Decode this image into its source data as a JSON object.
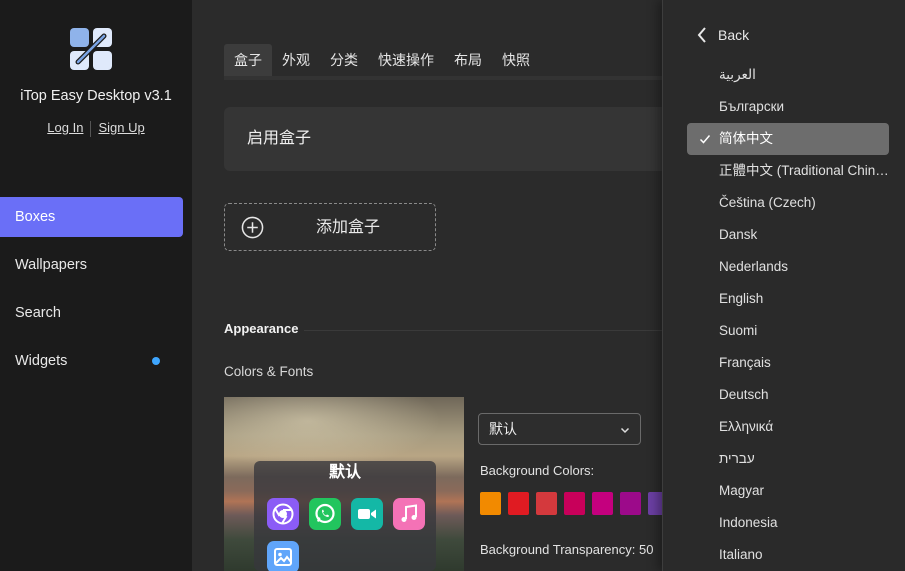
{
  "sidebar": {
    "app_title": "iTop Easy Desktop v3.1",
    "login": "Log In",
    "signup": "Sign Up",
    "nav": [
      "Boxes",
      "Wallpapers",
      "Search",
      "Widgets"
    ],
    "active_index": 0
  },
  "main": {
    "tabs": [
      "盒子",
      "外观",
      "分类",
      "快速操作",
      "布局",
      "快照"
    ],
    "active_tab": 0,
    "enable_label": "启用盒子",
    "add_box_label": "添加盒子",
    "appearance_title": "Appearance",
    "colors_fonts_title": "Colors & Fonts",
    "preview_title": "默认",
    "theme_select": "默认",
    "bg_colors_label": "Background Colors:",
    "bg_transparency_label": "Background Transparency: 50",
    "swatches": [
      "#f28a00",
      "#e01b22",
      "#d4393d",
      "#c8005a",
      "#c4007e",
      "#9c0a8a",
      "#6b3fa3"
    ],
    "app_icons": [
      "chrome-icon",
      "whatsapp-icon",
      "facetime-icon",
      "music-icon",
      "photos-icon"
    ]
  },
  "language_panel": {
    "back_label": "Back",
    "languages": [
      "العربية",
      "Български",
      "简体中文",
      "正體中文 (Traditional Chinese)",
      "Čeština (Czech)",
      "Dansk",
      "Nederlands",
      "English",
      "Suomi",
      "Français",
      "Deutsch",
      "Ελληνικά",
      "עברית",
      "Magyar",
      "Indonesia",
      "Italiano"
    ],
    "selected_index": 2
  }
}
